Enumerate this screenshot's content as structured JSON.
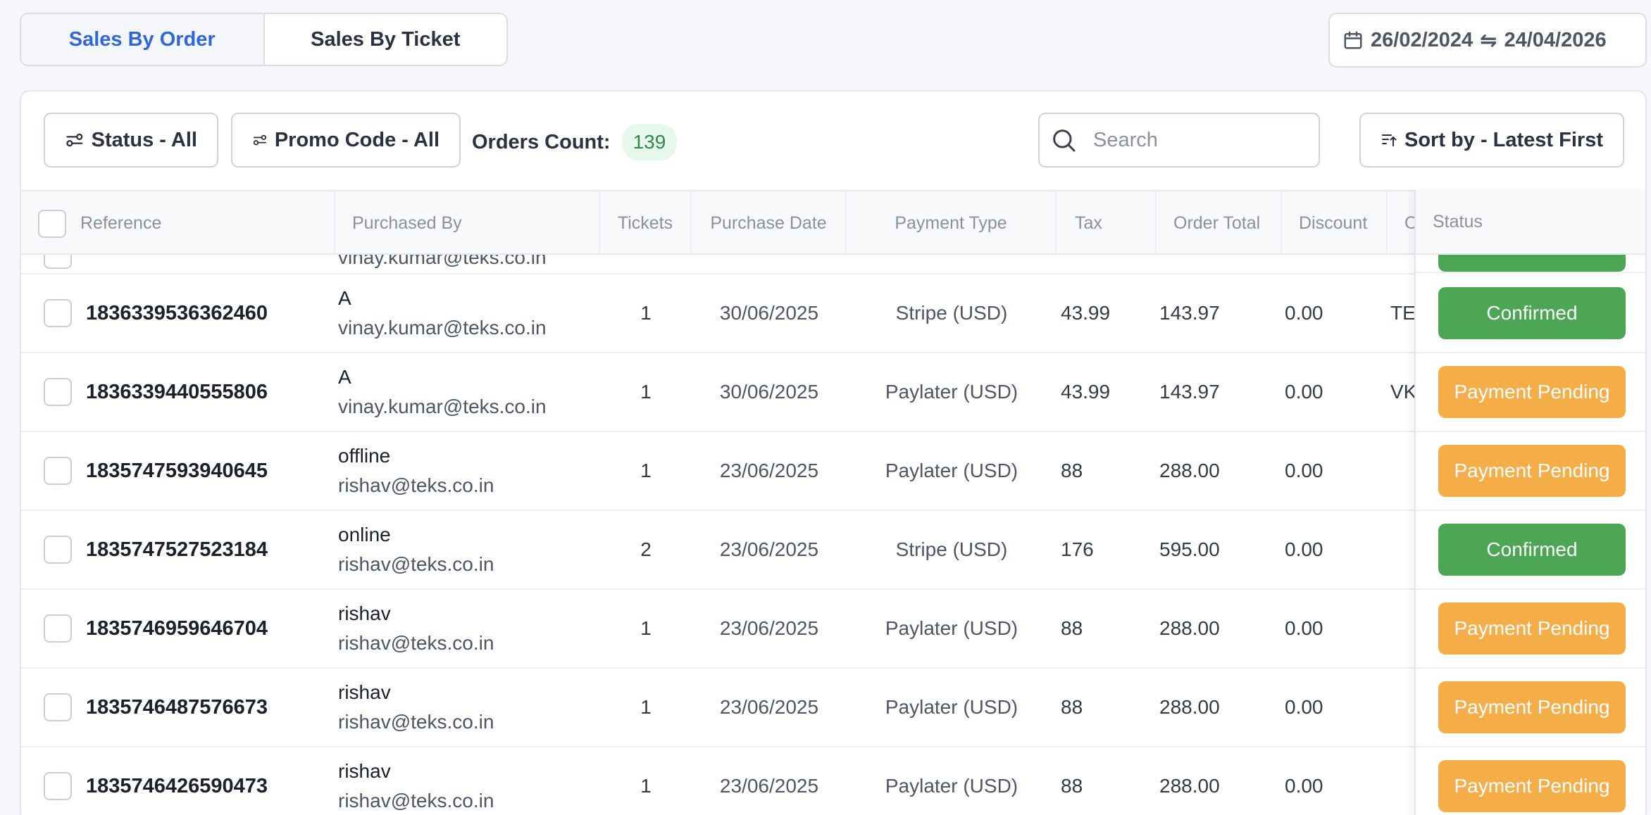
{
  "view_tabs": {
    "by_order": "Sales By Order",
    "by_ticket": "Sales By Ticket"
  },
  "date_range": {
    "start": "26/02/2024",
    "separator": "⇋",
    "end": "24/04/2026"
  },
  "toolbar": {
    "status_filter": "Status - All",
    "promo_filter": "Promo Code - All",
    "orders_count_label": "Orders Count:",
    "orders_count": "139",
    "search_placeholder": "Search",
    "sort_label": "Sort by - Latest First"
  },
  "table": {
    "columns": {
      "reference": "Reference",
      "purchased_by": "Purchased By",
      "tickets": "Tickets",
      "purchase_date": "Purchase Date",
      "payment_type": "Payment Type",
      "tax": "Tax",
      "order_total": "Order Total",
      "discount": "Discount",
      "organization": "Org",
      "status": "Status"
    },
    "partial_row": {
      "email": "vinay.kumar@teks.co.in"
    },
    "rows": [
      {
        "reference": "1836339536362460",
        "name": "A",
        "email": "vinay.kumar@teks.co.in",
        "tickets": "1",
        "date": "30/06/2025",
        "payment": "Stripe (USD)",
        "tax": "43.99",
        "total": "143.97",
        "discount": "0.00",
        "org": "TE",
        "status": "Confirmed"
      },
      {
        "reference": "1836339440555806",
        "name": "A",
        "email": "vinay.kumar@teks.co.in",
        "tickets": "1",
        "date": "30/06/2025",
        "payment": "Paylater (USD)",
        "tax": "43.99",
        "total": "143.97",
        "discount": "0.00",
        "org": "VK",
        "status": "Payment Pending"
      },
      {
        "reference": "1835747593940645",
        "name": "offline",
        "email": "rishav@teks.co.in",
        "tickets": "1",
        "date": "23/06/2025",
        "payment": "Paylater (USD)",
        "tax": "88",
        "total": "288.00",
        "discount": "0.00",
        "org": "",
        "status": "Payment Pending"
      },
      {
        "reference": "1835747527523184",
        "name": "online",
        "email": "rishav@teks.co.in",
        "tickets": "2",
        "date": "23/06/2025",
        "payment": "Stripe (USD)",
        "tax": "176",
        "total": "595.00",
        "discount": "0.00",
        "org": "",
        "status": "Confirmed"
      },
      {
        "reference": "1835746959646704",
        "name": "rishav",
        "email": "rishav@teks.co.in",
        "tickets": "1",
        "date": "23/06/2025",
        "payment": "Paylater (USD)",
        "tax": "88",
        "total": "288.00",
        "discount": "0.00",
        "org": "",
        "status": "Payment Pending"
      },
      {
        "reference": "1835746487576673",
        "name": "rishav",
        "email": "rishav@teks.co.in",
        "tickets": "1",
        "date": "23/06/2025",
        "payment": "Paylater (USD)",
        "tax": "88",
        "total": "288.00",
        "discount": "0.00",
        "org": "",
        "status": "Payment Pending"
      },
      {
        "reference": "1835746426590473",
        "name": "rishav",
        "email": "rishav@teks.co.in",
        "tickets": "1",
        "date": "23/06/2025",
        "payment": "Paylater (USD)",
        "tax": "88",
        "total": "288.00",
        "discount": "0.00",
        "org": "",
        "status": "Payment Pending"
      }
    ]
  },
  "colors": {
    "accent": "#2f66d9",
    "confirmed": "#4ca653",
    "pending": "#f5ad47",
    "count_badge_bg": "#e7f7ec"
  },
  "icons": [
    "calendar-icon",
    "filter-icon",
    "search-icon",
    "sort-icon"
  ]
}
